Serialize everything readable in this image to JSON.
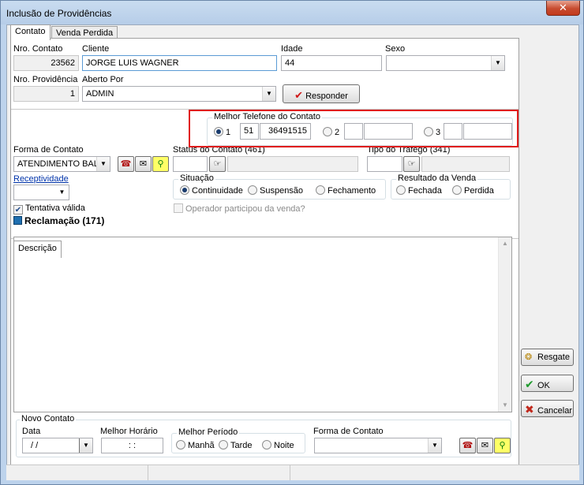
{
  "window": {
    "title": "Inclusão de Providências",
    "close_glyph": "✕"
  },
  "tabs": [
    {
      "label": "Contato"
    },
    {
      "label": "Venda Perdida"
    }
  ],
  "fields": {
    "nro_contato": {
      "label": "Nro. Contato",
      "value": "23562"
    },
    "cliente": {
      "label": "Cliente",
      "value": "JORGE LUIS WAGNER"
    },
    "idade": {
      "label": "Idade",
      "value": "44"
    },
    "sexo": {
      "label": "Sexo",
      "value": ""
    },
    "nro_providencia": {
      "label": "Nro. Providência",
      "value": "1"
    },
    "aberto_por": {
      "label": "Aberto Por",
      "value": "ADMIN"
    }
  },
  "responder_button": {
    "label": "Responder",
    "icon": "check-icon"
  },
  "melhor_telefone": {
    "title": "Melhor Telefone do Contato",
    "options": [
      {
        "label": "1",
        "ddd": "51",
        "number": "36491515",
        "selected": true
      },
      {
        "label": "2",
        "ddd": "",
        "number": "",
        "selected": false
      },
      {
        "label": "3",
        "ddd": "",
        "number": "",
        "selected": false
      }
    ]
  },
  "forma_contato": {
    "label": "Forma de Contato",
    "value": "ATENDIMENTO BALCÃO"
  },
  "status_contato": {
    "label": "Status do Contato (461)",
    "value": ""
  },
  "tipo_trafego": {
    "label": "Tipo do Tráfego (341)",
    "value": ""
  },
  "receptividade": {
    "label": "Receptividade",
    "value": ""
  },
  "situacao": {
    "title": "Situação",
    "options": [
      {
        "label": "Continuidade",
        "selected": true
      },
      {
        "label": "Suspensão",
        "selected": false
      },
      {
        "label": "Fechamento",
        "selected": false
      }
    ]
  },
  "resultado_venda": {
    "title": "Resultado da Venda",
    "options": [
      {
        "label": "Fechada",
        "selected": false
      },
      {
        "label": "Perdida",
        "selected": false
      }
    ]
  },
  "tentativa_valida": {
    "label": "Tentativa válida",
    "checked": true
  },
  "operador_participou": {
    "label": "Operador participou da venda?",
    "checked": false
  },
  "reclamacao": {
    "label": "Reclamação (171)"
  },
  "descricao_tab": {
    "label": "Descrição"
  },
  "novo_contato": {
    "title": "Novo Contato",
    "data": {
      "label": "Data",
      "value": " /  /"
    },
    "melhor_horario": {
      "label": "Melhor Horário",
      "value": ":  :"
    },
    "melhor_periodo": {
      "title": "Melhor Período",
      "options": [
        {
          "label": "Manhã",
          "selected": false
        },
        {
          "label": "Tarde",
          "selected": false
        },
        {
          "label": "Noite",
          "selected": false
        }
      ]
    },
    "forma_contato": {
      "label": "Forma de Contato",
      "value": ""
    }
  },
  "side_buttons": {
    "resgate": "Resgate",
    "ok": "OK",
    "cancelar": "Cancelar"
  },
  "colors": {
    "accent_red": "#e01b1b",
    "title_bar": "#bdd3ec",
    "check_green": "#1e9a2c",
    "cancel_red": "#c0281c"
  }
}
